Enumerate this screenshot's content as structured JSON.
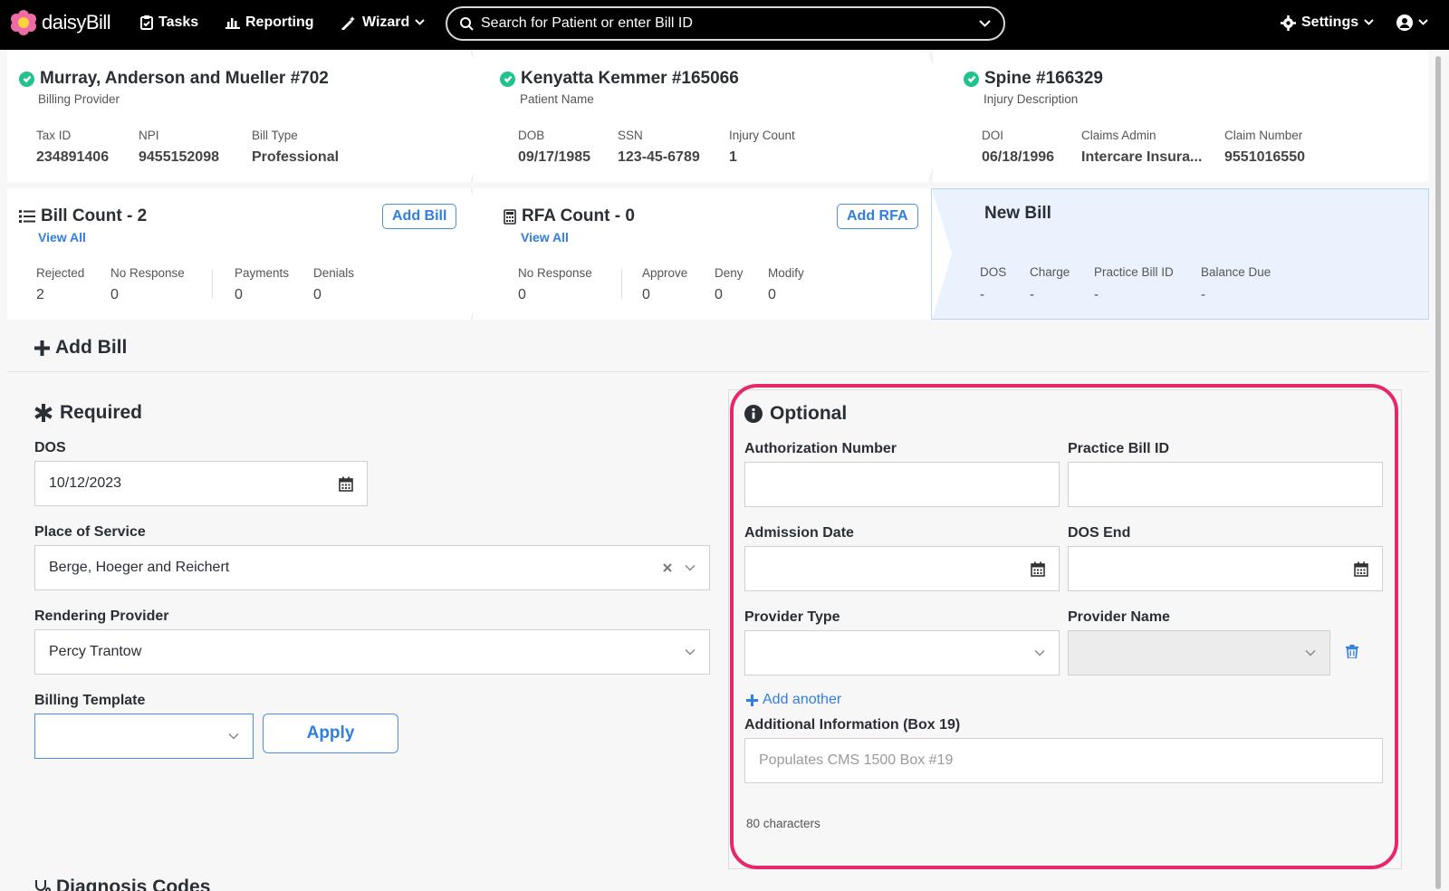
{
  "nav": {
    "brand": "daisyBill",
    "tasks": "Tasks",
    "reporting": "Reporting",
    "wizard": "Wizard",
    "search_placeholder": "Search for Patient or enter Bill ID",
    "settings": "Settings"
  },
  "provider_card": {
    "title": "Murray, Anderson and Mueller #702",
    "subtitle": "Billing Provider",
    "fields": [
      {
        "label": "Tax ID",
        "value": "234891406"
      },
      {
        "label": "NPI",
        "value": "9455152098"
      },
      {
        "label": "Bill Type",
        "value": "Professional"
      }
    ]
  },
  "patient_card": {
    "title": "Kenyatta Kemmer #165066",
    "subtitle": "Patient Name",
    "fields": [
      {
        "label": "DOB",
        "value": "09/17/1985"
      },
      {
        "label": "SSN",
        "value": "123-45-6789"
      },
      {
        "label": "Injury Count",
        "value": "1"
      }
    ]
  },
  "injury_card": {
    "title": "Spine #166329",
    "subtitle": "Injury Description",
    "fields": [
      {
        "label": "DOI",
        "value": "06/18/1996"
      },
      {
        "label": "Claims Admin",
        "value": "Intercare Insura..."
      },
      {
        "label": "Claim Number",
        "value": "9551016550"
      }
    ]
  },
  "bill_count_card": {
    "title": "Bill Count - 2",
    "view_all": "View All",
    "add_button": "Add Bill",
    "fields": [
      {
        "label": "Rejected",
        "value": "2"
      },
      {
        "label": "No Response",
        "value": "0"
      },
      {
        "label": "Payments",
        "value": "0"
      },
      {
        "label": "Denials",
        "value": "0"
      }
    ]
  },
  "rfa_card": {
    "title": "RFA Count - 0",
    "view_all": "View All",
    "add_button": "Add RFA",
    "fields": [
      {
        "label": "No Response",
        "value": "0"
      },
      {
        "label": "Approve",
        "value": "0"
      },
      {
        "label": "Deny",
        "value": "0"
      },
      {
        "label": "Modify",
        "value": "0"
      }
    ]
  },
  "new_bill_card": {
    "title": "New Bill",
    "fields": [
      {
        "label": "DOS",
        "value": "-"
      },
      {
        "label": "Charge",
        "value": "-"
      },
      {
        "label": "Practice Bill ID",
        "value": "-"
      },
      {
        "label": "Balance Due",
        "value": "-"
      }
    ]
  },
  "main": {
    "heading": "Add Bill",
    "required": {
      "title": "Required",
      "dos_label": "DOS",
      "dos_value": "10/12/2023",
      "pos_label": "Place of Service",
      "pos_value": "Berge, Hoeger and Reichert",
      "rendering_label": "Rendering Provider",
      "rendering_value": "Percy Trantow",
      "template_label": "Billing Template",
      "template_value": "",
      "apply": "Apply"
    },
    "optional": {
      "title": "Optional",
      "auth_label": "Authorization Number",
      "auth_value": "",
      "practice_bill_label": "Practice Bill ID",
      "practice_bill_value": "",
      "admission_label": "Admission Date",
      "admission_value": "",
      "dos_end_label": "DOS End",
      "dos_end_value": "",
      "provider_type_label": "Provider Type",
      "provider_type_value": "",
      "provider_name_label": "Provider Name",
      "provider_name_value": "",
      "add_another": "Add another",
      "additional_label": "Additional Information (Box 19)",
      "additional_placeholder": "Populates CMS 1500 Box #19",
      "char_count": "80 characters"
    },
    "diagnosis_heading": "Diagnosis Codes"
  },
  "colors": {
    "accent": "#2f7ee0",
    "success": "#21c28e",
    "highlight": "#e8266c",
    "navbar": "#000000"
  }
}
